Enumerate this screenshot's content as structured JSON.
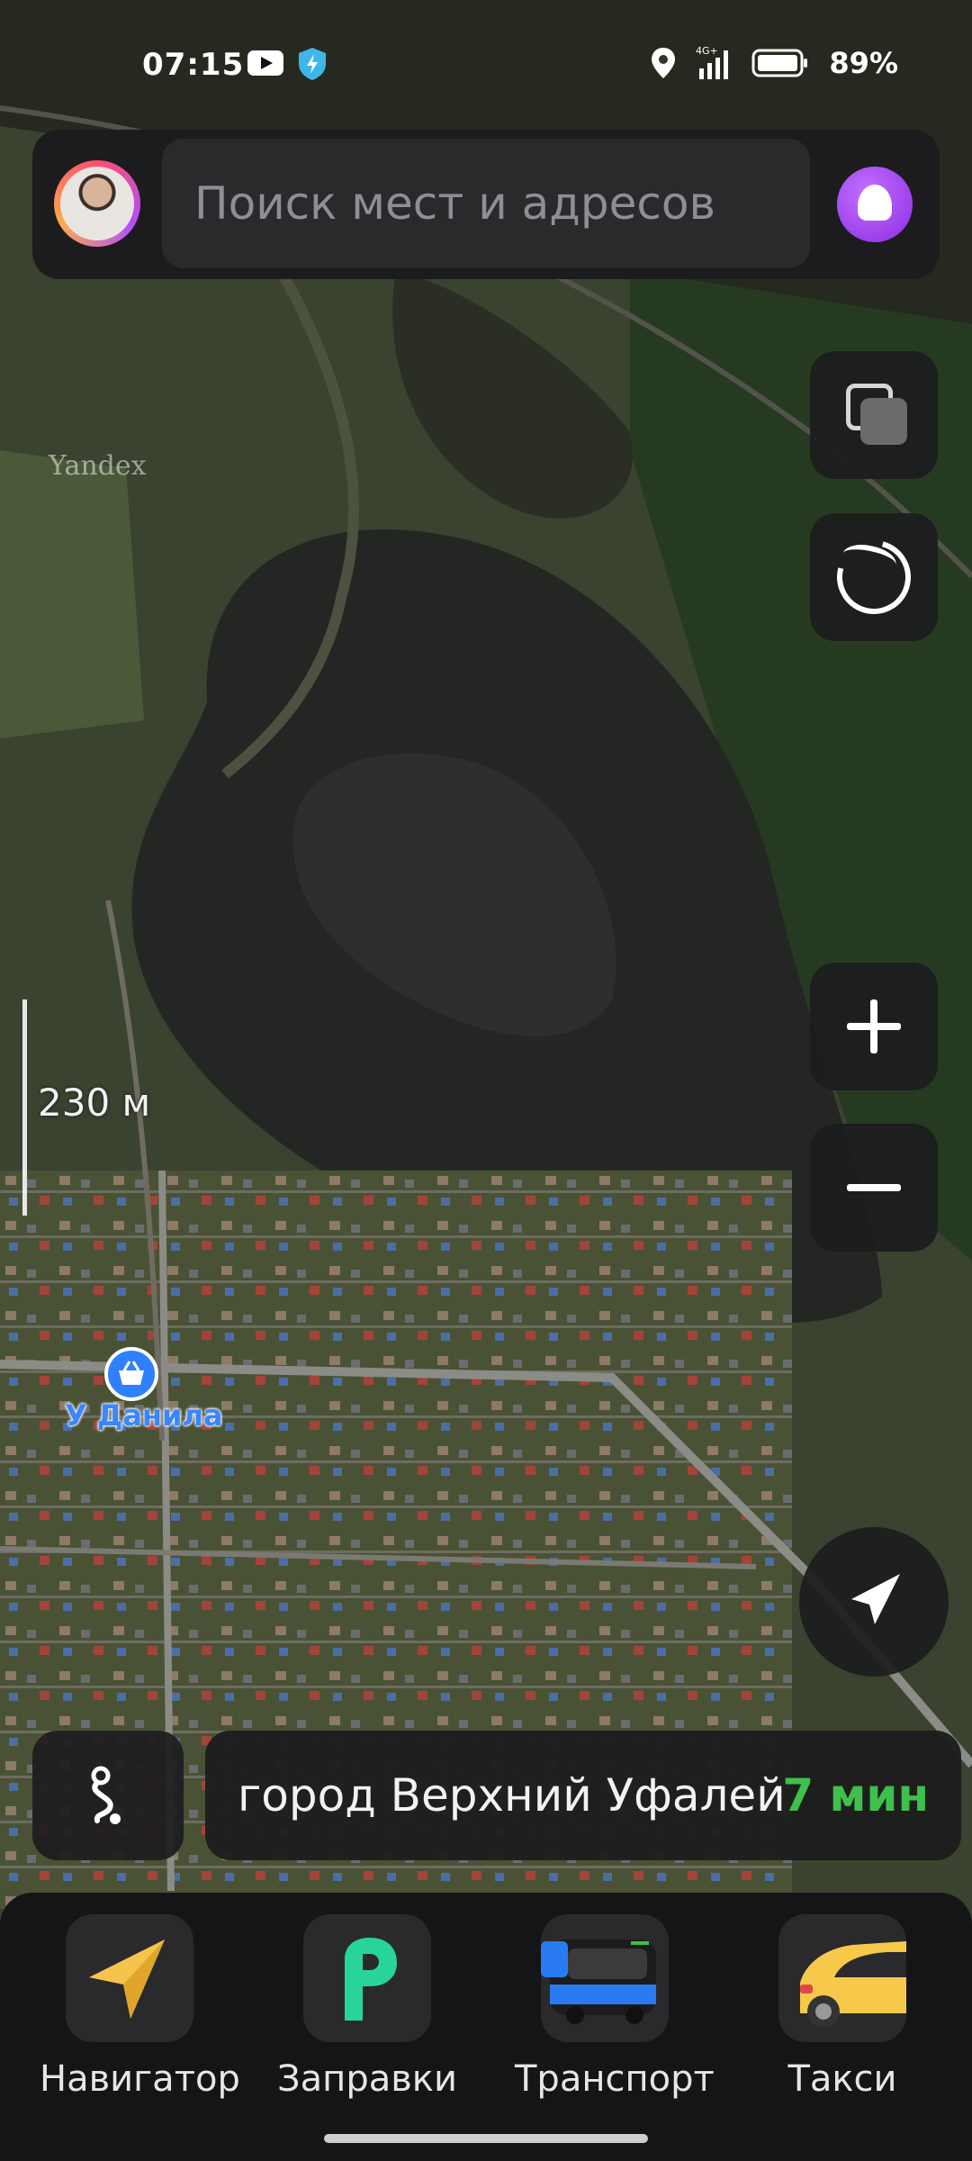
{
  "status_bar": {
    "time": "07:15",
    "battery": "89%",
    "network": "4G+"
  },
  "search": {
    "placeholder": "Поиск мест и адресов"
  },
  "map": {
    "watermark": "Yandex",
    "scale": "230 м",
    "poi": {
      "label": "У Данила",
      "icon": "basket-icon"
    }
  },
  "controls": [
    "layers-icon",
    "ar-icon",
    "zoom-in-icon",
    "zoom-out-icon",
    "locate-arrow-icon",
    "routes-icon"
  ],
  "destination": {
    "text": "город Верхний Уфалей",
    "time": "7 мин"
  },
  "services": [
    {
      "label": "Навигатор",
      "icon": "navigator-icon"
    },
    {
      "label": "Заправки",
      "icon": "fuel-icon"
    },
    {
      "label": "Транспорт",
      "icon": "bus-icon"
    },
    {
      "label": "Такси",
      "icon": "taxi-icon"
    }
  ],
  "colors": {
    "accent_green": "#3ec04a",
    "poi_blue": "#3a86ff",
    "alice_purple": "#8a2be2",
    "panel": "#1c1c1e"
  }
}
